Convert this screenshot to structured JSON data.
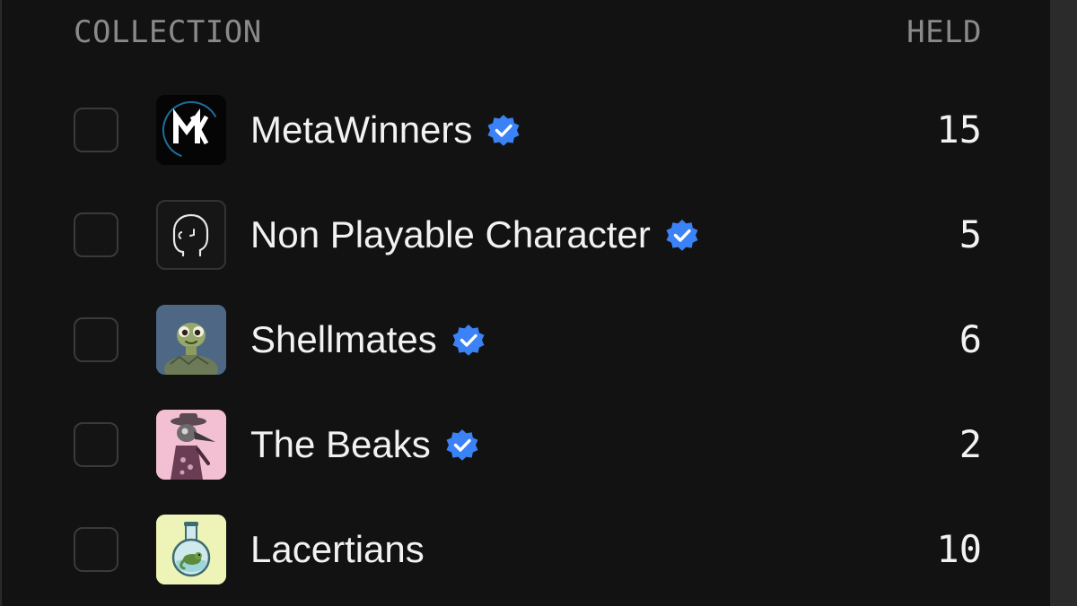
{
  "header": {
    "collection_label": "COLLECTION",
    "held_label": "HELD"
  },
  "colors": {
    "background": "#121212",
    "text": "#f2f2f2",
    "muted": "#8a8a8a",
    "verified_badge": "#3b82f6"
  },
  "collections": [
    {
      "name": "MetaWinners",
      "verified": true,
      "held": "15",
      "avatar_icon": "metawinners-logo-icon",
      "checked": false
    },
    {
      "name": "Non Playable Character",
      "verified": true,
      "held": "5",
      "avatar_icon": "npc-head-outline-icon",
      "checked": false
    },
    {
      "name": "Shellmates",
      "verified": true,
      "held": "6",
      "avatar_icon": "turtle-avatar-icon",
      "checked": false
    },
    {
      "name": "The Beaks",
      "verified": true,
      "held": "2",
      "avatar_icon": "plague-bird-avatar-icon",
      "checked": false
    },
    {
      "name": "Lacertians",
      "verified": false,
      "held": "10",
      "avatar_icon": "lizard-flask-avatar-icon",
      "checked": false
    }
  ]
}
